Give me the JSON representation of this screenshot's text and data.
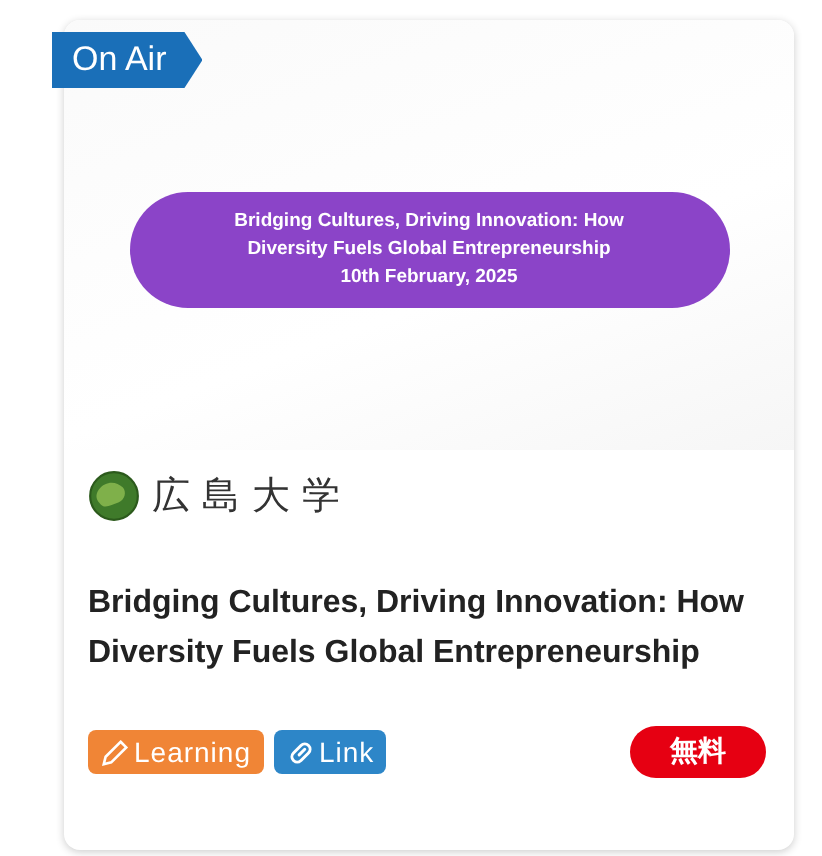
{
  "status_ribbon": {
    "label": "On Air"
  },
  "banner": {
    "lines": [
      "Bridging Cultures, Driving Innovation: How",
      "Diversity Fuels Global Entrepreneurship",
      "10th February, 2025"
    ]
  },
  "organizer": {
    "name": "広島大学"
  },
  "title": "Bridging Cultures, Driving Innovation: How Diversity Fuels Global Entrepreneurship",
  "tags": [
    {
      "kind": "learning",
      "label": "Learning"
    },
    {
      "kind": "link",
      "label": "Link"
    }
  ],
  "price": {
    "label": "無料"
  }
}
